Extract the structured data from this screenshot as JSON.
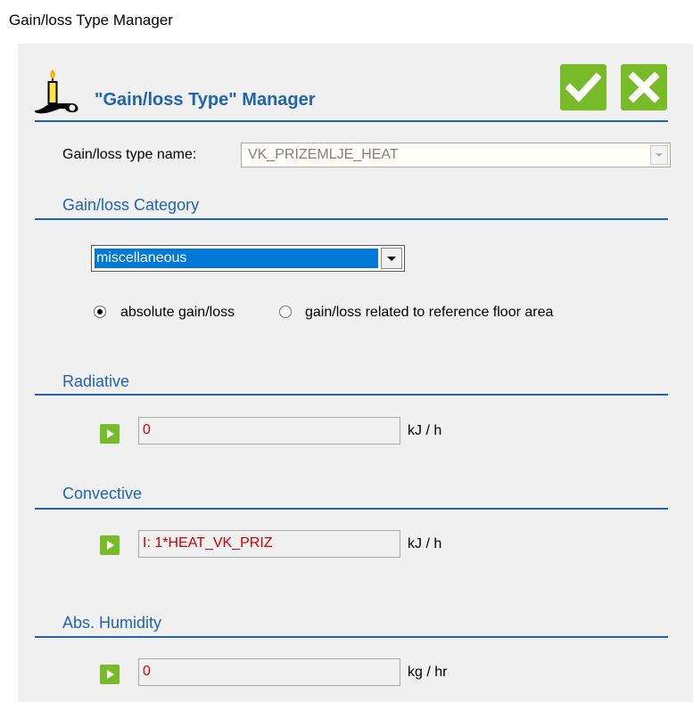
{
  "window": {
    "title": "Gain/loss Type Manager"
  },
  "header": {
    "title": "\"Gain/loss Type\" Manager",
    "ok_icon": "checkmark-icon",
    "cancel_icon": "close-icon",
    "logo_icon": "candle-icon",
    "accent_color": "#77bb28",
    "title_color": "#1f64b0"
  },
  "name_row": {
    "label": "Gain/loss type name:",
    "value": "VK_PRIZEMLJE_HEAT"
  },
  "category": {
    "section_title": "Gain/loss Category",
    "selected": "miscellaneous",
    "radios": [
      {
        "label": "absolute gain/loss",
        "checked": true
      },
      {
        "label": "gain/loss related to reference floor area",
        "checked": false
      }
    ]
  },
  "radiative": {
    "section_title": "Radiative",
    "value": "0",
    "unit": "kJ / h"
  },
  "convective": {
    "section_title": "Convective",
    "value": "I: 1*HEAT_VK_PRIZ",
    "unit": "kJ / h"
  },
  "humidity": {
    "section_title": "Abs. Humidity",
    "value": "0",
    "unit": "kg / hr"
  }
}
